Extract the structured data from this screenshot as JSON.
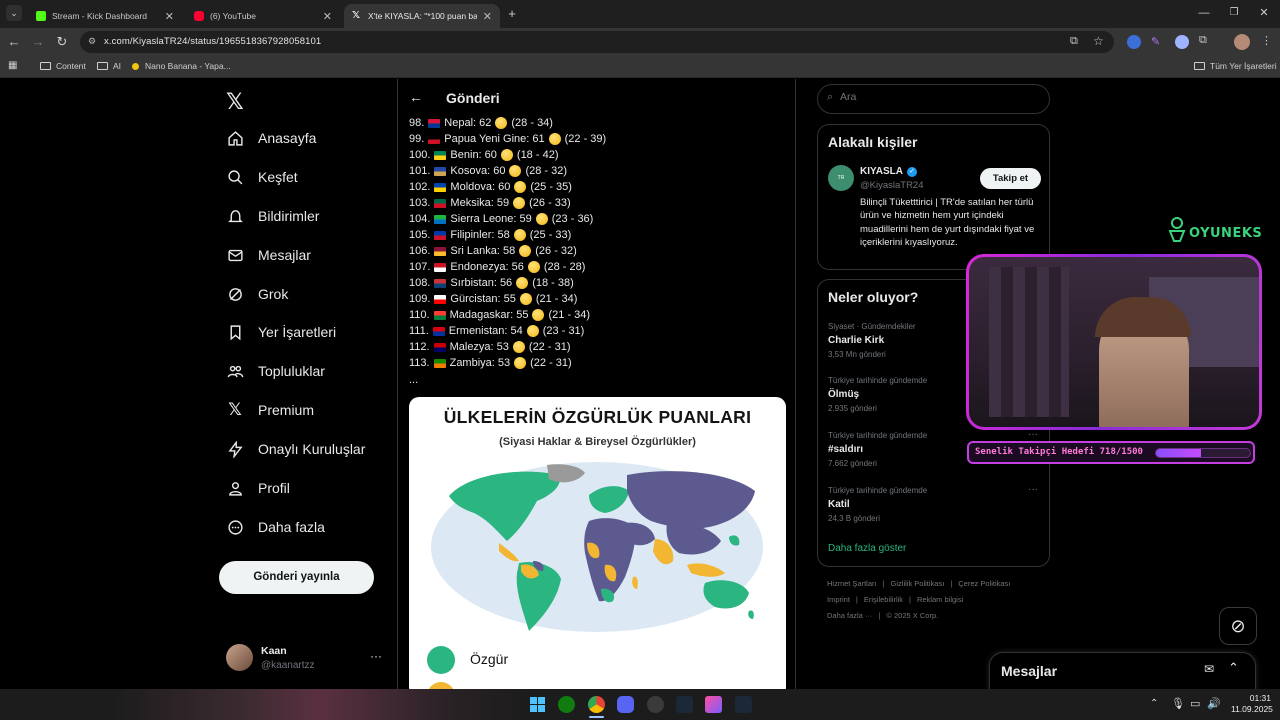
{
  "browser": {
    "tabs": [
      {
        "title": "Stream - Kick Dashboard",
        "favicon_color": "#53fc18"
      },
      {
        "title": "(6) YouTube",
        "favicon_color": "#ff0033"
      },
      {
        "title": "X'te KIYASLA: \"*100 puan baz al",
        "favicon_color": "#ffffff"
      }
    ],
    "url": "x.com/KiyaslaTR24/status/1965518367928058101",
    "bookmarks": [
      "Content",
      "AI",
      "Nano Banana - Yapa..."
    ],
    "all_bookmarks": "Tüm Yer İşaretleri"
  },
  "sidebar": {
    "items": [
      {
        "label": "Anasayfa",
        "icon": "home-icon"
      },
      {
        "label": "Keşfet",
        "icon": "search-icon"
      },
      {
        "label": "Bildirimler",
        "icon": "bell-icon"
      },
      {
        "label": "Mesajlar",
        "icon": "mail-icon"
      },
      {
        "label": "Grok",
        "icon": "grok-icon"
      },
      {
        "label": "Yer İşaretleri",
        "icon": "bookmark-icon"
      },
      {
        "label": "Topluluklar",
        "icon": "communities-icon"
      },
      {
        "label": "Premium",
        "icon": "x-logo-icon"
      },
      {
        "label": "Onaylı Kuruluşlar",
        "icon": "lightning-icon"
      },
      {
        "label": "Profil",
        "icon": "person-icon"
      },
      {
        "label": "Daha fazla",
        "icon": "more-circle-icon"
      }
    ],
    "post_button": "Gönderi yayınla",
    "account": {
      "name": "Kaan",
      "handle": "@kaanartzz"
    }
  },
  "post": {
    "header": "Gönderi",
    "lines": [
      {
        "num": "98.",
        "country": "Nepal: 62",
        "range": "(28 - 34)",
        "flag": [
          "#dc143c",
          "#003893"
        ]
      },
      {
        "num": "99.",
        "country": "Papua Yeni Gine: 61",
        "range": "(22 - 39)",
        "flag": [
          "#000000",
          "#ce1126"
        ]
      },
      {
        "num": "100.",
        "country": "Benin: 60",
        "range": "(18 - 42)",
        "flag": [
          "#008751",
          "#fcd116"
        ]
      },
      {
        "num": "101.",
        "country": "Kosova: 60",
        "range": "(28 - 32)",
        "flag": [
          "#244aa5",
          "#d0a650"
        ]
      },
      {
        "num": "102.",
        "country": "Moldova: 60",
        "range": "(25 - 35)",
        "flag": [
          "#0046ae",
          "#ffd200"
        ]
      },
      {
        "num": "103.",
        "country": "Meksika: 59",
        "range": "(26 - 33)",
        "flag": [
          "#006847",
          "#ce1126"
        ]
      },
      {
        "num": "104.",
        "country": "Sierra Leone: 59",
        "range": "(23 - 36)",
        "flag": [
          "#1eb53a",
          "#0072c6"
        ]
      },
      {
        "num": "105.",
        "country": "Filipinler: 58",
        "range": "(25 - 33)",
        "flag": [
          "#0038a8",
          "#ce1126"
        ]
      },
      {
        "num": "106.",
        "country": "Sri Lanka: 58",
        "range": "(26 - 32)",
        "flag": [
          "#8d153a",
          "#ffbe29"
        ]
      },
      {
        "num": "107.",
        "country": "Endonezya: 56",
        "range": "(28 - 28)",
        "flag": [
          "#ce1126",
          "#ffffff"
        ]
      },
      {
        "num": "108.",
        "country": "Sırbistan: 56",
        "range": "(18 - 38)",
        "flag": [
          "#c6363c",
          "#0c4076"
        ]
      },
      {
        "num": "109.",
        "country": "Gürcistan: 55",
        "range": "(21 - 34)",
        "flag": [
          "#ffffff",
          "#ff0000"
        ]
      },
      {
        "num": "110.",
        "country": "Madagaskar: 55",
        "range": "(21 - 34)",
        "flag": [
          "#fc3d32",
          "#007e3a"
        ]
      },
      {
        "num": "111.",
        "country": "Ermenistan: 54",
        "range": "(23 - 31)",
        "flag": [
          "#d90012",
          "#0033a0"
        ]
      },
      {
        "num": "112.",
        "country": "Malezya: 53",
        "range": "(22 - 31)",
        "flag": [
          "#cc0001",
          "#010066"
        ]
      },
      {
        "num": "113.",
        "country": "Zambiya: 53",
        "range": "(22 - 31)",
        "flag": [
          "#198a00",
          "#ef7d00"
        ]
      }
    ],
    "ellipsis": "...",
    "image": {
      "title": "ÜLKELERİN ÖZGÜRLÜK PUANLARI",
      "subtitle": "(Siyasi Haklar & Bireysel Özgürlükler)",
      "legend": [
        {
          "label": "Özgür",
          "color": "#2bb580"
        }
      ],
      "colors": {
        "free": "#2bb580",
        "partly": "#f2b632",
        "notfree": "#5c5a8f",
        "nodata": "#9a9a9a",
        "ocean": "#dce9f4"
      }
    }
  },
  "right": {
    "search_placeholder": "Ara",
    "related": {
      "title": "Alakalı kişiler",
      "name": "KIYASLA",
      "handle": "@KiyaslaTR24",
      "follow": "Takip et",
      "bio": "Bilinçli Tüketttirici | TR'de satılan her türlü ürün ve hizmetin hem yurt içindeki muadillerini hem de yurt dışındaki fiyat ve içeriklerini kıyaslıyoruz."
    },
    "trends": {
      "title": "Neler oluyor?",
      "items": [
        {
          "context": "Siyaset · Gündemdekiler",
          "name": "Charlie Kirk",
          "count": "3,53 Mn gönderi"
        },
        {
          "context": "Türkiye tarihinde gündemde",
          "name": "Ölmüş",
          "count": "2.935 gönderi"
        },
        {
          "context": "Türkiye tarihinde gündemde",
          "name": "#saldırı",
          "count": "7.662 gönderi"
        },
        {
          "context": "Türkiye tarihinde gündemde",
          "name": "Katil",
          "count": "24,3 B gönderi"
        }
      ],
      "show_more": "Daha fazla göster"
    },
    "footer": [
      "Hizmet Şartları",
      "Gizlilik Politikası",
      "Çerez Politikası",
      "Imprint",
      "Erişilebilirlik",
      "Reklam bilgisi",
      "Daha fazla ···",
      "© 2025 X Corp."
    ]
  },
  "overlay": {
    "brand": "OYUNEKS",
    "follower_goal": "Senelik Takipçi Hedefi 718/1500",
    "progress": 0.48
  },
  "messages_dock": {
    "title": "Mesajlar"
  },
  "taskbar": {
    "time": "01:31",
    "date": "11.09.2025"
  }
}
